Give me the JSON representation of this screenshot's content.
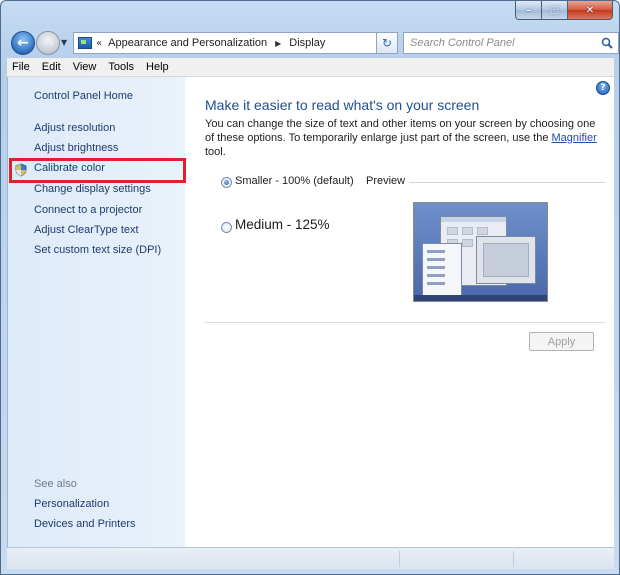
{
  "window": {
    "caption_minimize": "–",
    "caption_maximize": "□",
    "caption_close": "✕"
  },
  "nav": {
    "back_icon": "back-arrow-icon",
    "forward_icon": "forward-arrow-icon",
    "address_overflow": "«",
    "breadcrumbs": [
      "Appearance and Personalization",
      "Display"
    ],
    "search_placeholder": "Search Control Panel"
  },
  "menu": [
    "File",
    "Edit",
    "View",
    "Tools",
    "Help"
  ],
  "sidebar": {
    "home": "Control Panel Home",
    "tasks": [
      "Adjust resolution",
      "Adjust brightness",
      "Calibrate color",
      "Change display settings",
      "Connect to a projector",
      "Adjust ClearType text",
      "Set custom text size (DPI)"
    ],
    "see_also_title": "See also",
    "see_also": [
      "Personalization",
      "Devices and Printers"
    ],
    "highlight_color": "#e0202a"
  },
  "main": {
    "heading": "Make it easier to read what's on your screen",
    "desc_before": "You can change the size of text and other items on your screen by choosing one of these options. To temporarily enlarge just part of the screen, use the ",
    "desc_link": "Magnifier",
    "desc_after": " tool.",
    "options": [
      {
        "label": "Smaller - 100% (default)",
        "checked": true
      },
      {
        "label": "Medium - 125%",
        "checked": false
      }
    ],
    "preview_label": "Preview",
    "apply_label": "Apply",
    "help": "?"
  }
}
